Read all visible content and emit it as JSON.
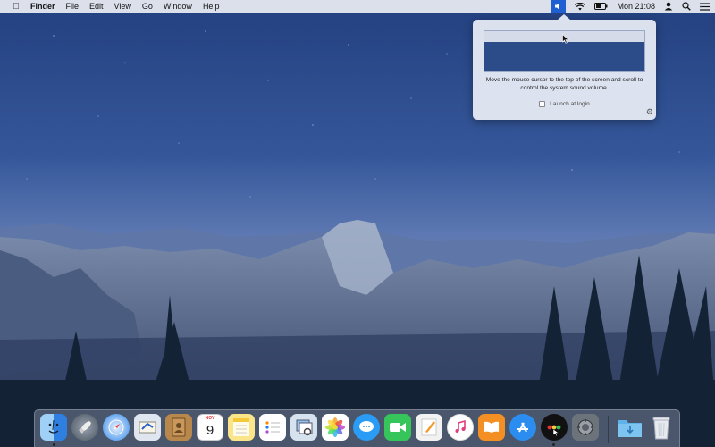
{
  "menubar": {
    "apple_icon": "apple-icon",
    "app_name": "Finder",
    "menus": [
      "File",
      "Edit",
      "View",
      "Go",
      "Window",
      "Help"
    ],
    "status_icons": [
      "volume-icon",
      "wifi-icon",
      "battery-icon"
    ],
    "clock": "Mon 21:08",
    "extra_icons": [
      "user-icon",
      "spotlight-icon",
      "notification-center-icon"
    ]
  },
  "popover": {
    "hint": "Move the mouse cursor to the top of the screen and scroll to control the system sound volume.",
    "launch_at_login": {
      "label": "Launch at login",
      "checked": false
    }
  },
  "dock": {
    "apps": [
      {
        "name": "Finder",
        "icon": "finder-icon"
      },
      {
        "name": "Launchpad",
        "icon": "launchpad-icon"
      },
      {
        "name": "Safari",
        "icon": "safari-icon"
      },
      {
        "name": "Mail",
        "icon": "mail-icon"
      },
      {
        "name": "Contacts",
        "icon": "contacts-icon"
      },
      {
        "name": "Calendar",
        "icon": "calendar-icon",
        "month": "NOV",
        "day": "9"
      },
      {
        "name": "Notes",
        "icon": "notes-icon"
      },
      {
        "name": "Reminders",
        "icon": "reminders-icon"
      },
      {
        "name": "Preview",
        "icon": "preview-icon"
      },
      {
        "name": "Photos",
        "icon": "photos-icon"
      },
      {
        "name": "Messages",
        "icon": "messages-icon"
      },
      {
        "name": "FaceTime",
        "icon": "facetime-icon"
      },
      {
        "name": "Pages",
        "icon": "pages-icon"
      },
      {
        "name": "iTunes",
        "icon": "itunes-icon"
      },
      {
        "name": "iBooks",
        "icon": "ibooks-icon"
      },
      {
        "name": "App Store",
        "icon": "app-store-icon"
      },
      {
        "name": "Volume Scroller",
        "icon": "volume-app-icon"
      },
      {
        "name": "System Preferences",
        "icon": "system-preferences-icon"
      }
    ],
    "downloads_icon": "downloads-folder-icon",
    "trash_icon": "trash-icon"
  }
}
